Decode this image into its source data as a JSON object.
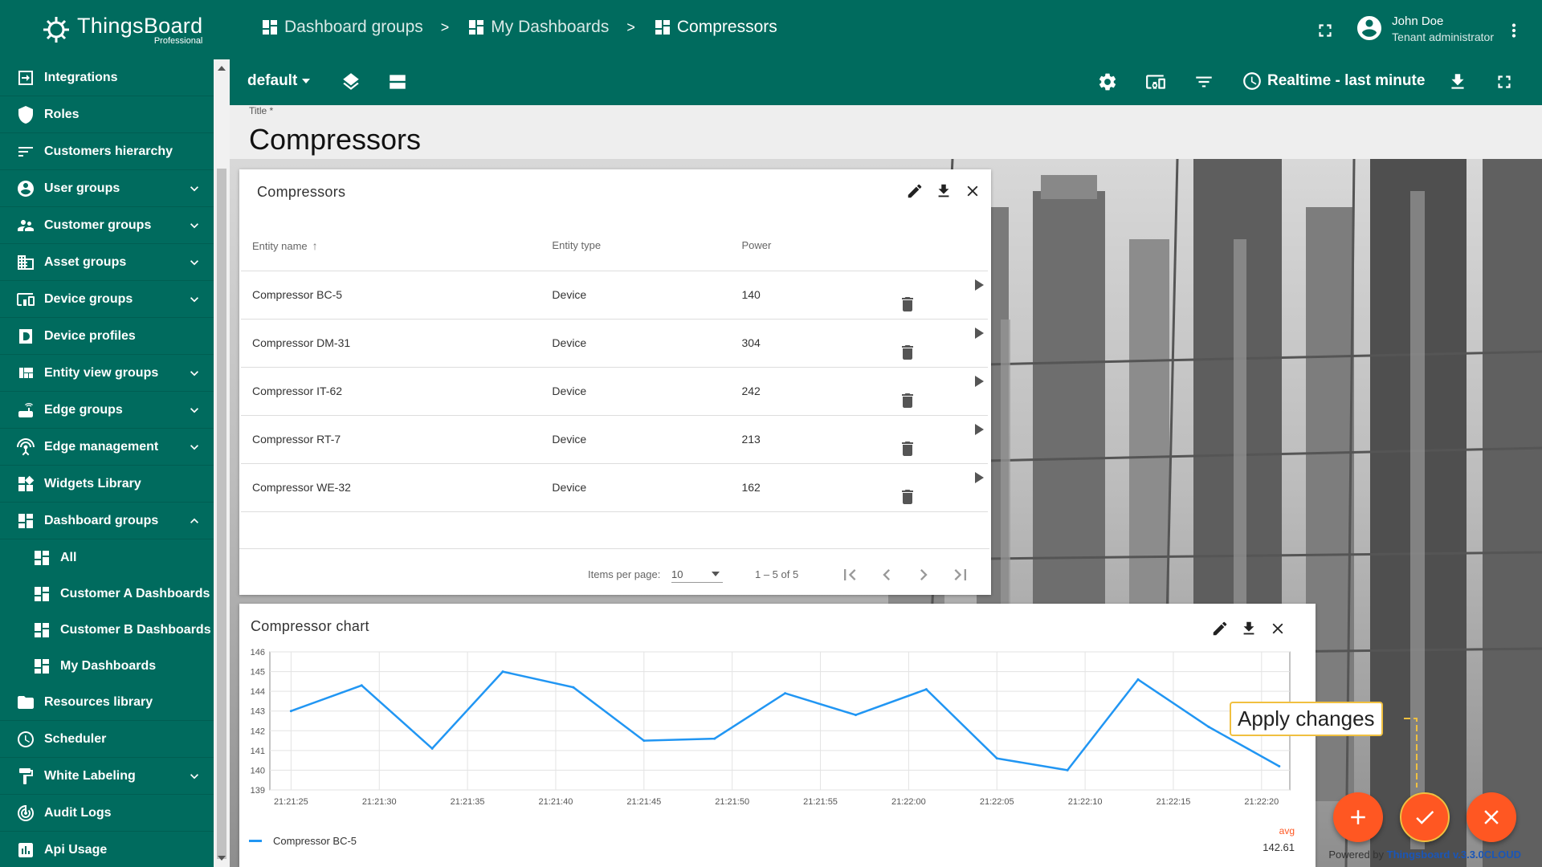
{
  "app": {
    "name": "ThingsBoard",
    "edition": "Professional"
  },
  "sidebar": {
    "items": [
      {
        "label": "Integrations",
        "icon": "integrations-icon"
      },
      {
        "label": "Roles",
        "icon": "shield-icon"
      },
      {
        "label": "Customers hierarchy",
        "icon": "sort-icon"
      },
      {
        "label": "User groups",
        "icon": "account-circle-icon",
        "expandable": true
      },
      {
        "label": "Customer groups",
        "icon": "supervisor-icon",
        "expandable": true
      },
      {
        "label": "Asset groups",
        "icon": "domain-icon",
        "expandable": true
      },
      {
        "label": "Device groups",
        "icon": "devices-other-icon",
        "expandable": true
      },
      {
        "label": "Device profiles",
        "icon": "device-profile-icon"
      },
      {
        "label": "Entity view groups",
        "icon": "view-quilt-icon",
        "expandable": true
      },
      {
        "label": "Edge groups",
        "icon": "router-icon",
        "expandable": true
      },
      {
        "label": "Edge management",
        "icon": "settings-input-antenna-icon",
        "expandable": true
      },
      {
        "label": "Widgets Library",
        "icon": "widgets-icon"
      },
      {
        "label": "Dashboard groups",
        "icon": "dashboard-icon",
        "expanded": true
      },
      {
        "label": "All",
        "icon": "dashboard-icon",
        "sub": true
      },
      {
        "label": "Customer A Dashboards",
        "icon": "dashboard-icon",
        "sub": true
      },
      {
        "label": "Customer B Dashboards",
        "icon": "dashboard-icon",
        "sub": true
      },
      {
        "label": "My Dashboards",
        "icon": "dashboard-icon",
        "sub": true
      },
      {
        "label": "Resources library",
        "icon": "folder-icon"
      },
      {
        "label": "Scheduler",
        "icon": "schedule-icon"
      },
      {
        "label": "White Labeling",
        "icon": "format-paint-icon",
        "expandable": true
      },
      {
        "label": "Audit Logs",
        "icon": "track-changes-icon"
      },
      {
        "label": "Api Usage",
        "icon": "insert-chart-icon"
      }
    ]
  },
  "breadcrumbs": [
    {
      "label": "Dashboard groups"
    },
    {
      "label": "My Dashboards"
    },
    {
      "label": "Compressors"
    }
  ],
  "breadcrumb_separator": ">",
  "user": {
    "name": "John Doe",
    "role": "Tenant administrator"
  },
  "toolbar": {
    "state": "default",
    "timewindow": "Realtime - last minute"
  },
  "title_field": {
    "label": "Title *",
    "value": "Compressors"
  },
  "entities_widget": {
    "title": "Compressors",
    "columns": [
      "Entity name",
      "Entity type",
      "Power"
    ],
    "rows": [
      [
        "Compressor BC-5",
        "Device",
        "140"
      ],
      [
        "Compressor DM-31",
        "Device",
        "304"
      ],
      [
        "Compressor IT-62",
        "Device",
        "242"
      ],
      [
        "Compressor RT-7",
        "Device",
        "213"
      ],
      [
        "Compressor WE-32",
        "Device",
        "162"
      ]
    ],
    "pager": {
      "items_per_page_label": "Items per page:",
      "items_per_page": "10",
      "range": "1 – 5 of 5"
    }
  },
  "chart_widget": {
    "title": "Compressor chart",
    "avg_label": "avg",
    "avg_value": "142.61",
    "legend": "Compressor BC-5"
  },
  "chart_data": {
    "type": "line",
    "x": [
      "21:21:25",
      "21:21:30",
      "21:21:35",
      "21:21:40",
      "21:21:45",
      "21:21:50",
      "21:21:55",
      "21:22:00",
      "21:22:05",
      "21:22:10",
      "21:22:15",
      "21:22:20"
    ],
    "points": [
      {
        "t": "21:21:25",
        "v": 143.0
      },
      {
        "t": "21:21:29",
        "v": 144.3
      },
      {
        "t": "21:21:33",
        "v": 141.1
      },
      {
        "t": "21:21:37",
        "v": 145.0
      },
      {
        "t": "21:21:41",
        "v": 144.2
      },
      {
        "t": "21:21:45",
        "v": 141.5
      },
      {
        "t": "21:21:49",
        "v": 141.6
      },
      {
        "t": "21:21:53",
        "v": 143.9
      },
      {
        "t": "21:21:57",
        "v": 142.8
      },
      {
        "t": "21:22:01",
        "v": 144.1
      },
      {
        "t": "21:22:05",
        "v": 140.6
      },
      {
        "t": "21:22:09",
        "v": 140.0
      },
      {
        "t": "21:22:13",
        "v": 144.6
      },
      {
        "t": "21:22:17",
        "v": 142.2
      },
      {
        "t": "21:22:21",
        "v": 140.2
      }
    ],
    "yticks": [
      139,
      140,
      141,
      142,
      143,
      144,
      145,
      146
    ],
    "ylim": [
      139,
      146
    ],
    "series": [
      {
        "name": "Compressor BC-5",
        "color": "#2196f3"
      }
    ],
    "grid": true
  },
  "fabs": {
    "apply_tooltip": "Apply changes"
  },
  "footer": {
    "powered_prefix": "Powered by",
    "powered_link": "Thingsboard v.3.3.0CLOUD"
  },
  "colors": {
    "primary": "#006b5e",
    "accent": "#ff5722",
    "series": "#2196f3"
  }
}
